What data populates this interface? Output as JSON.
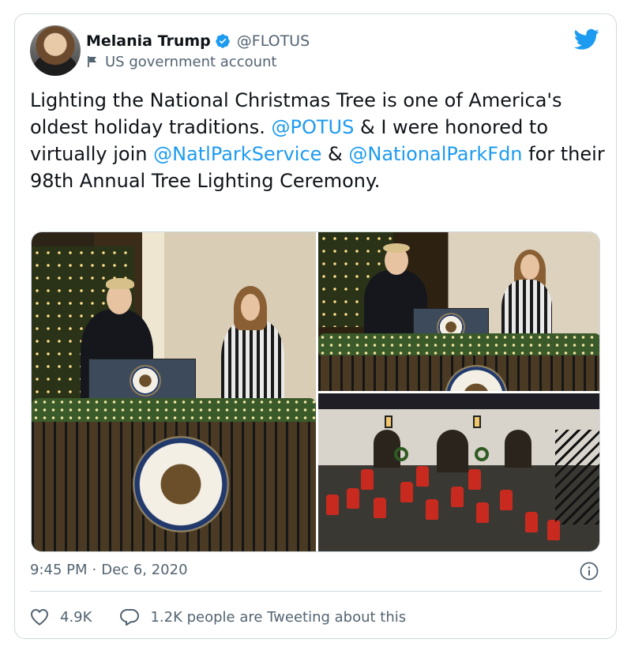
{
  "author": {
    "name": "Melania Trump",
    "handle": "@FLOTUS",
    "label": "US government account"
  },
  "tweet": {
    "parts": [
      {
        "text": "Lighting the National Christmas Tree is one of America's oldest holiday traditions. ",
        "type": "text"
      },
      {
        "text": "@POTUS",
        "type": "mention"
      },
      {
        "text": " & I were honored to virtually join ",
        "type": "text"
      },
      {
        "text": "@NatlParkService",
        "type": "mention"
      },
      {
        "text": " & ",
        "type": "text"
      },
      {
        "text": "@NationalParkFdn",
        "type": "mention"
      },
      {
        "text": " for their 98th Annual Tree Lighting Ceremony.",
        "type": "text"
      }
    ]
  },
  "meta": {
    "time": "9:45 PM",
    "separator": "·",
    "date": "Dec 6, 2020"
  },
  "stats": {
    "likes": "4.9K",
    "conversation": "1.2K people are Tweeting about this"
  },
  "icons": {
    "verified": "verified-badge-icon",
    "government": "flag-icon",
    "platform": "twitter-bird-icon",
    "info": "info-icon",
    "like": "heart-icon",
    "reply": "reply-icon"
  },
  "colors": {
    "accent": "#1d9bf0",
    "muted": "#536471",
    "text": "#0f1419",
    "border": "#cfd9de"
  }
}
